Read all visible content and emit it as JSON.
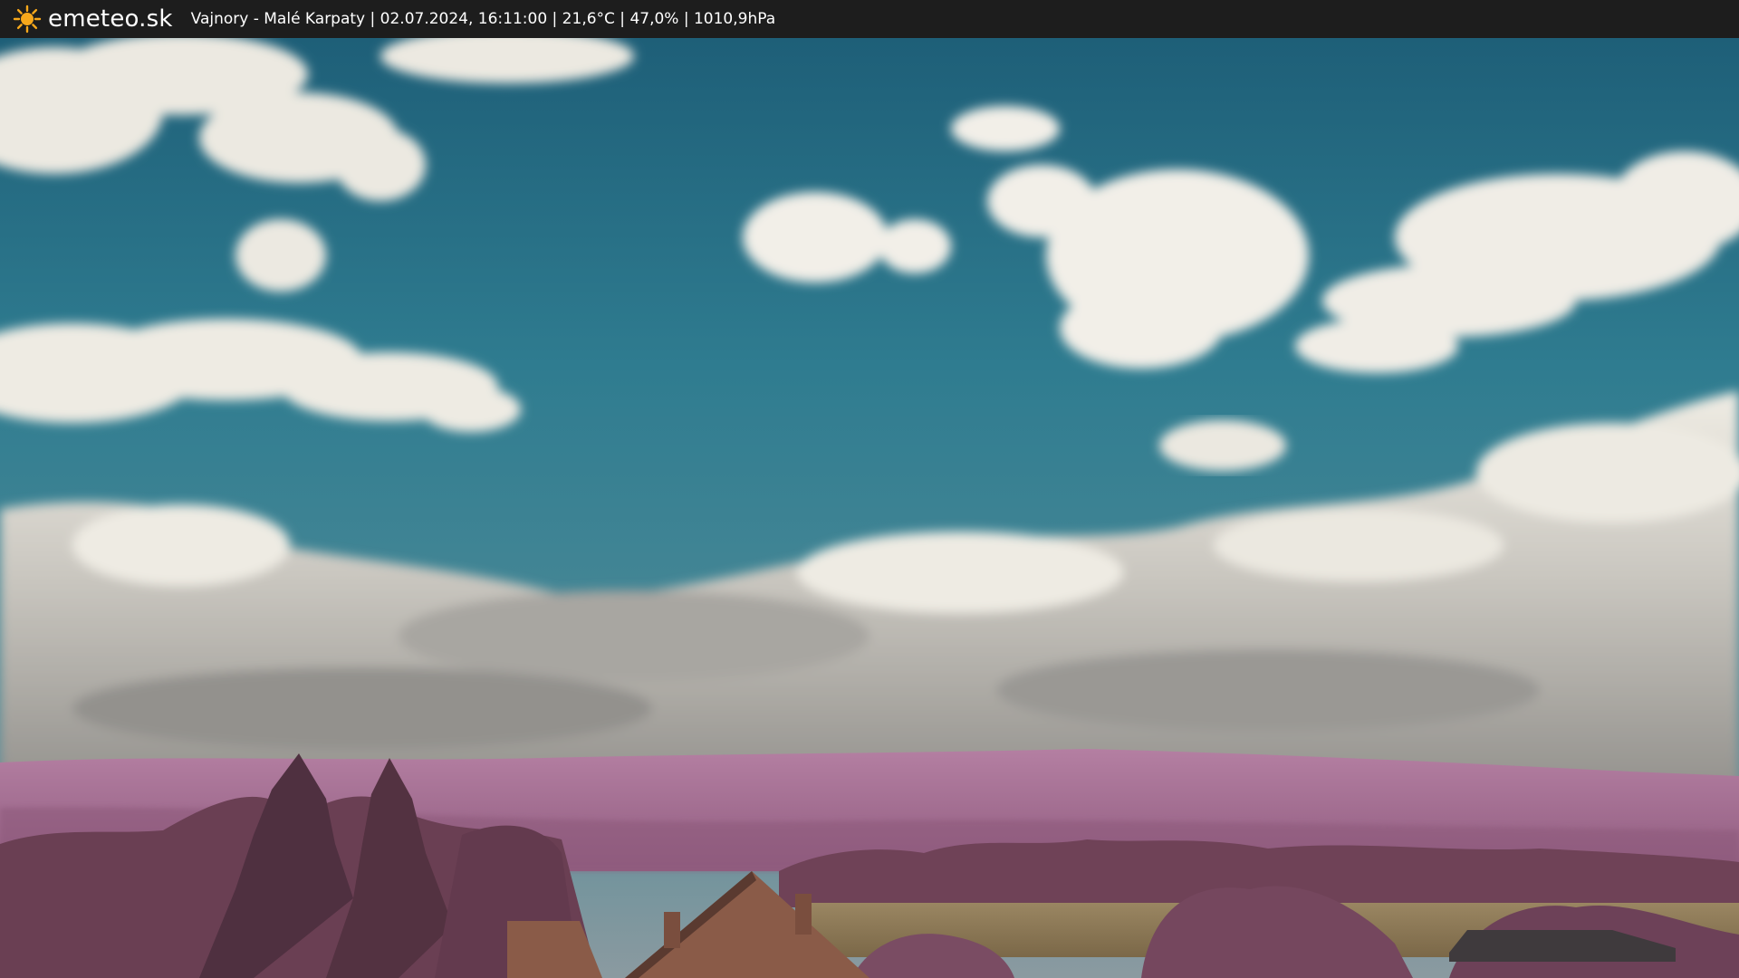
{
  "header": {
    "brand": "emeteo.sk",
    "logo_icon": "sun-icon",
    "caption": "Vajnory - Malé Karpaty | 02.07.2024, 16:11:00 | 21,6°C | 47,0% | 1010,9hPa"
  },
  "colors": {
    "bar_background": "#1d1d1d",
    "sun_fill": "#f7a81b",
    "sky_top": "#1e5f78",
    "sky_mid": "#2f7c90",
    "sky_low": "#4c8a97",
    "cloud_light": "#f1eee6",
    "cloud_shadow": "#8f8d89",
    "hills": "#a36f92",
    "trees_dark": "#5d3947",
    "trees_mid": "#7a4c63",
    "field": "#8e7a58",
    "roof": "#8a5b48"
  }
}
